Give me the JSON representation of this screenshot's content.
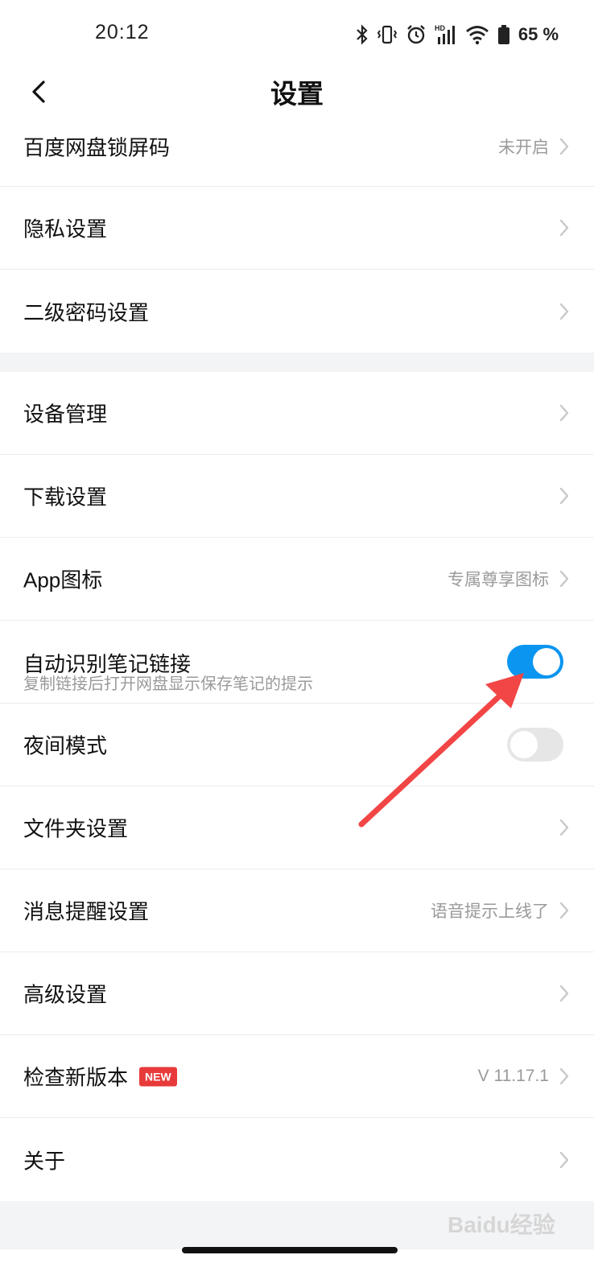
{
  "status_bar": {
    "time": "20:12",
    "battery": "65",
    "battery_unit": "%",
    "icons": [
      "bluetooth-icon",
      "vibrate-icon",
      "alarm-icon",
      "hd-signal-icon",
      "wifi-icon",
      "battery-icon"
    ]
  },
  "nav": {
    "title": "设置",
    "back_icon": "chevron-left-icon"
  },
  "settings": {
    "lock_screen": {
      "label": "百度网盘锁屏码",
      "value": "未开启"
    },
    "privacy": {
      "label": "隐私设置"
    },
    "second_password": {
      "label": "二级密码设置"
    },
    "device_mgmt": {
      "label": "设备管理"
    },
    "download": {
      "label": "下载设置"
    },
    "app_icon": {
      "label": "App图标",
      "value": "专属尊享图标"
    },
    "auto_note_link": {
      "label": "自动识别笔记链接",
      "sub": "复制链接后打开网盘显示保存笔记的提示",
      "enabled": true
    },
    "night_mode": {
      "label": "夜间模式",
      "enabled": false
    },
    "folder": {
      "label": "文件夹设置"
    },
    "notify": {
      "label": "消息提醒设置",
      "value": "语音提示上线了"
    },
    "advanced": {
      "label": "高级设置"
    },
    "check_update": {
      "label": "检查新版本",
      "badge": "NEW",
      "value": "V 11.17.1"
    },
    "about": {
      "label": "关于"
    }
  },
  "colors": {
    "toggle_on": "#0a95f0",
    "toggle_off": "#e6e6e6",
    "badge": "#e83a3a",
    "annotation_arrow": "#f24545"
  },
  "watermark": "Baidu经验"
}
